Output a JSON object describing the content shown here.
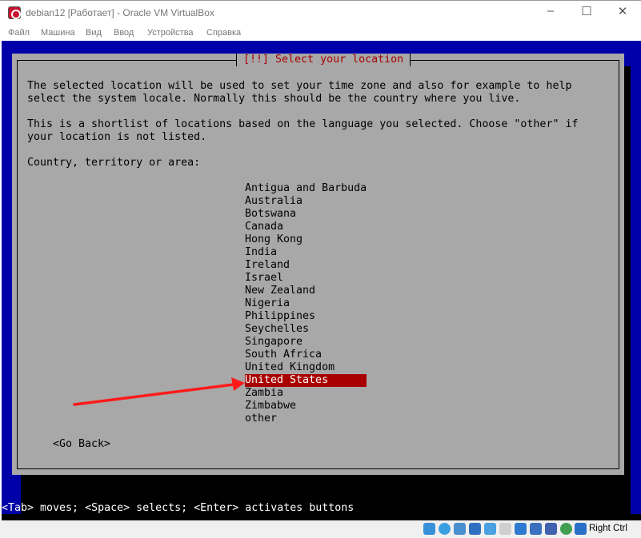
{
  "window": {
    "title": "debian12 [Работает] - Oracle VM VirtualBox",
    "minimize": "–",
    "maximize": "☐",
    "close": "✕"
  },
  "menu": [
    "Файл",
    "Машина",
    "Вид",
    "Ввод",
    "Устройства",
    "Справка"
  ],
  "dialog": {
    "title": "[!!] Select your location",
    "paragraphs": [
      "The selected location will be used to set your time zone and also for example to help",
      "select the system locale. Normally this should be the country where you live.",
      "This is a shortlist of locations based on the language you selected. Choose \"other\" if",
      "your location is not listed."
    ],
    "prompt": "Country, territory or area:",
    "options": [
      "Antigua and Barbuda",
      "Australia",
      "Botswana",
      "Canada",
      "Hong Kong",
      "India",
      "Ireland",
      "Israel",
      "New Zealand",
      "Nigeria",
      "Philippines",
      "Seychelles",
      "Singapore",
      "South Africa",
      "United Kingdom",
      "United States",
      "Zambia",
      "Zimbabwe",
      "other"
    ],
    "selected": "United States",
    "go_back": "<Go Back>"
  },
  "help_line": "<Tab> moves; <Space> selects; <Enter> activates buttons",
  "statusbar": {
    "icons": [
      "hard-disk-icon",
      "optical-disk-icon",
      "audio-icon",
      "network-icon",
      "usb-icon",
      "shared-folders-icon",
      "display-icon",
      "video-capture-icon",
      "virtualization-icon",
      "mouse-integration-icon",
      "keyboard-capture-icon"
    ],
    "host_key": "Right Ctrl"
  },
  "colors": {
    "screen": "#0000a8",
    "dialog": "#a8a8a8",
    "highlight": "#a80000",
    "arrow": "#ff1a1a"
  }
}
